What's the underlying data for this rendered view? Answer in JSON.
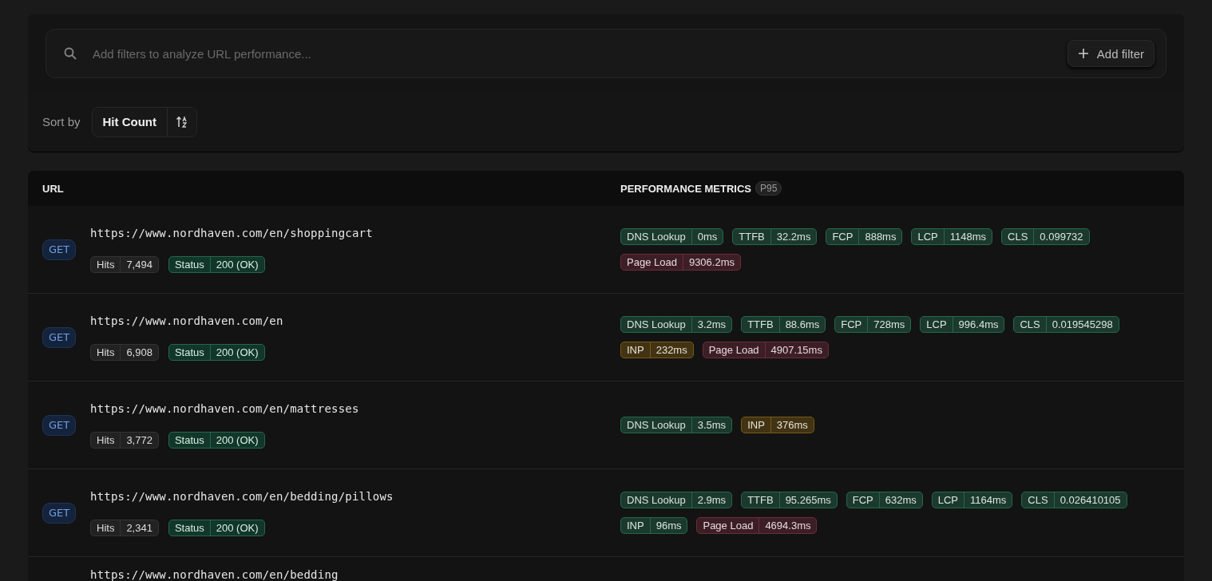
{
  "filter_bar": {
    "placeholder": "Add filters to analyze URL performance...",
    "add_button": "Add filter"
  },
  "sort": {
    "label": "Sort by",
    "value": "Hit Count"
  },
  "table": {
    "columns": [
      "URL",
      "PERFORMANCE METRICS"
    ],
    "percentile_badge": "P95",
    "rows": [
      {
        "method": "GET",
        "url": "https://www.nordhaven.com/en/shoppingcart",
        "hits_label": "Hits",
        "hits": "7,494",
        "status_label": "Status",
        "status": "200 (OK)",
        "metrics": [
          {
            "name": "DNS Lookup",
            "value": "0ms",
            "color": "#24684d"
          },
          {
            "name": "TTFB",
            "value": "32.2ms",
            "color": "#24684d"
          },
          {
            "name": "FCP",
            "value": "888ms",
            "color": "#24684d"
          },
          {
            "name": "LCP",
            "value": "1148ms",
            "color": "#24684d"
          },
          {
            "name": "CLS",
            "value": "0.099732",
            "color": "#24684d"
          },
          {
            "name": "Page Load",
            "value": "9306.2ms",
            "color": "#6e2b3c"
          }
        ]
      },
      {
        "method": "GET",
        "url": "https://www.nordhaven.com/en",
        "hits_label": "Hits",
        "hits": "6,908",
        "status_label": "Status",
        "status": "200 (OK)",
        "metrics": [
          {
            "name": "DNS Lookup",
            "value": "3.2ms",
            "color": "#24684d"
          },
          {
            "name": "TTFB",
            "value": "88.6ms",
            "color": "#24684d"
          },
          {
            "name": "FCP",
            "value": "728ms",
            "color": "#24684d"
          },
          {
            "name": "LCP",
            "value": "996.4ms",
            "color": "#24684d"
          },
          {
            "name": "CLS",
            "value": "0.019545298",
            "color": "#24684d"
          },
          {
            "name": "INP",
            "value": "232ms",
            "color": "#7a5a14"
          },
          {
            "name": "Page Load",
            "value": "4907.15ms",
            "color": "#6e2b3c"
          }
        ]
      },
      {
        "method": "GET",
        "url": "https://www.nordhaven.com/en/mattresses",
        "hits_label": "Hits",
        "hits": "3,772",
        "status_label": "Status",
        "status": "200 (OK)",
        "metrics": [
          {
            "name": "DNS Lookup",
            "value": "3.5ms",
            "color": "#24684d"
          },
          {
            "name": "INP",
            "value": "376ms",
            "color": "#7a5a14"
          }
        ]
      },
      {
        "method": "GET",
        "url": "https://www.nordhaven.com/en/bedding/pillows",
        "hits_label": "Hits",
        "hits": "2,341",
        "status_label": "Status",
        "status": "200 (OK)",
        "metrics": [
          {
            "name": "DNS Lookup",
            "value": "2.9ms",
            "color": "#24684d"
          },
          {
            "name": "TTFB",
            "value": "95.265ms",
            "color": "#24684d"
          },
          {
            "name": "FCP",
            "value": "632ms",
            "color": "#24684d"
          },
          {
            "name": "LCP",
            "value": "1164ms",
            "color": "#24684d"
          },
          {
            "name": "CLS",
            "value": "0.026410105",
            "color": "#24684d"
          },
          {
            "name": "INP",
            "value": "96ms",
            "color": "#24684d"
          },
          {
            "name": "Page Load",
            "value": "4694.3ms",
            "color": "#6e2b3c"
          }
        ]
      },
      {
        "url": "https://www.nordhaven.com/en/bedding"
      }
    ]
  }
}
